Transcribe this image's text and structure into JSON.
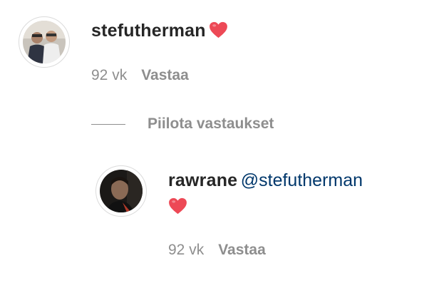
{
  "comments": [
    {
      "username": "stefutherman",
      "text_emoji": "heart",
      "time": "92 vk",
      "reply_label": "Vastaa"
    }
  ],
  "replies_toggle": {
    "label": "Piilota vastaukset"
  },
  "replies": [
    {
      "username": "rawrane",
      "mention": "@stefutherman",
      "text_emoji": "heart",
      "time": "92 vk",
      "reply_label": "Vastaa"
    }
  ],
  "colors": {
    "text": "#262626",
    "secondary": "#8e8e8e",
    "mention": "#00376b",
    "heart": "#ed4956"
  }
}
